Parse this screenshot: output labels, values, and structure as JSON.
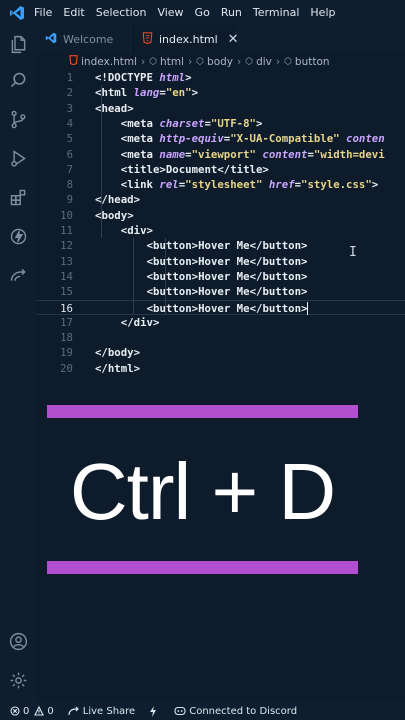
{
  "menu": [
    "File",
    "Edit",
    "Selection",
    "View",
    "Go",
    "Run",
    "Terminal",
    "Help"
  ],
  "tabs": [
    {
      "label": "Welcome",
      "active": false
    },
    {
      "label": "index.html",
      "active": true,
      "close": "✕"
    }
  ],
  "breadcrumb": [
    "index.html",
    "html",
    "body",
    "div",
    "button"
  ],
  "code_lines": [
    {
      "n": "1",
      "tokens": [
        [
          "t-br",
          "<!"
        ],
        [
          "t-tag",
          "DOCTYPE "
        ],
        [
          "t-attr",
          "html"
        ],
        [
          "t-br",
          ">"
        ]
      ],
      "indent": 0
    },
    {
      "n": "2",
      "tokens": [
        [
          "t-br",
          "<"
        ],
        [
          "t-tag",
          "html "
        ],
        [
          "t-attr",
          "lang"
        ],
        [
          "t-br",
          "="
        ],
        [
          "t-str",
          "\"en\""
        ],
        [
          "t-br",
          ">"
        ]
      ],
      "indent": 0
    },
    {
      "n": "3",
      "tokens": [
        [
          "t-br",
          "<"
        ],
        [
          "t-tag",
          "head"
        ],
        [
          "t-br",
          ">"
        ]
      ],
      "indent": 0
    },
    {
      "n": "4",
      "tokens": [
        [
          "t-br",
          "<"
        ],
        [
          "t-tag",
          "meta "
        ],
        [
          "t-attr",
          "charset"
        ],
        [
          "t-br",
          "="
        ],
        [
          "t-str",
          "\"UTF-8\""
        ],
        [
          "t-br",
          ">"
        ]
      ],
      "indent": 2
    },
    {
      "n": "5",
      "tokens": [
        [
          "t-br",
          "<"
        ],
        [
          "t-tag",
          "meta "
        ],
        [
          "t-attr",
          "http-equiv"
        ],
        [
          "t-br",
          "="
        ],
        [
          "t-str",
          "\"X-UA-Compatible\""
        ],
        [
          "t-txt",
          " "
        ],
        [
          "t-attr",
          "conten"
        ]
      ],
      "indent": 2
    },
    {
      "n": "6",
      "tokens": [
        [
          "t-br",
          "<"
        ],
        [
          "t-tag",
          "meta "
        ],
        [
          "t-attr",
          "name"
        ],
        [
          "t-br",
          "="
        ],
        [
          "t-str",
          "\"viewport\""
        ],
        [
          "t-txt",
          " "
        ],
        [
          "t-attr",
          "content"
        ],
        [
          "t-br",
          "="
        ],
        [
          "t-str",
          "\"width=devi"
        ]
      ],
      "indent": 2
    },
    {
      "n": "7",
      "tokens": [
        [
          "t-br",
          "<"
        ],
        [
          "t-tag",
          "title"
        ],
        [
          "t-br",
          ">"
        ],
        [
          "t-txt",
          "Document"
        ],
        [
          "t-br",
          "</"
        ],
        [
          "t-tag",
          "title"
        ],
        [
          "t-br",
          ">"
        ]
      ],
      "indent": 2
    },
    {
      "n": "8",
      "tokens": [
        [
          "t-br",
          "<"
        ],
        [
          "t-tag",
          "link "
        ],
        [
          "t-attr",
          "rel"
        ],
        [
          "t-br",
          "="
        ],
        [
          "t-str",
          "\"stylesheet\""
        ],
        [
          "t-txt",
          " "
        ],
        [
          "t-attr",
          "href"
        ],
        [
          "t-br",
          "="
        ],
        [
          "t-str",
          "\"style.css\""
        ],
        [
          "t-br",
          ">"
        ]
      ],
      "indent": 2
    },
    {
      "n": "9",
      "tokens": [
        [
          "t-br",
          "</"
        ],
        [
          "t-tag",
          "head"
        ],
        [
          "t-br",
          ">"
        ]
      ],
      "indent": 0
    },
    {
      "n": "10",
      "tokens": [
        [
          "t-br",
          "<"
        ],
        [
          "t-tag",
          "body"
        ],
        [
          "t-br",
          ">"
        ]
      ],
      "indent": 0
    },
    {
      "n": "11",
      "tokens": [
        [
          "t-br",
          "<"
        ],
        [
          "t-tag",
          "div"
        ],
        [
          "t-br",
          ">"
        ]
      ],
      "indent": 2
    },
    {
      "n": "12",
      "tokens": [
        [
          "t-br",
          "<"
        ],
        [
          "t-tag",
          "button"
        ],
        [
          "t-br",
          ">"
        ],
        [
          "t-txt",
          "Hover Me"
        ],
        [
          "t-br",
          "</"
        ],
        [
          "t-tag",
          "button"
        ],
        [
          "t-br",
          ">"
        ]
      ],
      "indent": 4
    },
    {
      "n": "13",
      "tokens": [
        [
          "t-br",
          "<"
        ],
        [
          "t-tag",
          "button"
        ],
        [
          "t-br",
          ">"
        ],
        [
          "t-txt",
          "Hover Me"
        ],
        [
          "t-br",
          "</"
        ],
        [
          "t-tag",
          "button"
        ],
        [
          "t-br",
          ">"
        ]
      ],
      "indent": 4
    },
    {
      "n": "14",
      "tokens": [
        [
          "t-br",
          "<"
        ],
        [
          "t-tag",
          "button"
        ],
        [
          "t-br",
          ">"
        ],
        [
          "t-txt",
          "Hover Me"
        ],
        [
          "t-br",
          "</"
        ],
        [
          "t-tag",
          "button"
        ],
        [
          "t-br",
          ">"
        ]
      ],
      "indent": 4
    },
    {
      "n": "15",
      "tokens": [
        [
          "t-br",
          "<"
        ],
        [
          "t-tag",
          "button"
        ],
        [
          "t-br",
          ">"
        ],
        [
          "t-txt",
          "Hover Me"
        ],
        [
          "t-br",
          "</"
        ],
        [
          "t-tag",
          "button"
        ],
        [
          "t-br",
          ">"
        ]
      ],
      "indent": 4
    },
    {
      "n": "16",
      "tokens": [
        [
          "t-br",
          "<"
        ],
        [
          "t-tag",
          "button"
        ],
        [
          "t-br",
          ">"
        ],
        [
          "t-txt",
          "Hover Me"
        ],
        [
          "t-br",
          "</"
        ],
        [
          "t-tag",
          "button"
        ],
        [
          "t-br",
          ">"
        ]
      ],
      "indent": 4,
      "current": true
    },
    {
      "n": "17",
      "tokens": [
        [
          "t-br",
          "</"
        ],
        [
          "t-tag",
          "div"
        ],
        [
          "t-br",
          ">"
        ]
      ],
      "indent": 2
    },
    {
      "n": "18",
      "tokens": [],
      "indent": 0
    },
    {
      "n": "19",
      "tokens": [
        [
          "t-br",
          "</"
        ],
        [
          "t-tag",
          "body"
        ],
        [
          "t-br",
          ">"
        ]
      ],
      "indent": 0
    },
    {
      "n": "20",
      "tokens": [
        [
          "t-br",
          "</"
        ],
        [
          "t-tag",
          "html"
        ],
        [
          "t-br",
          ">"
        ]
      ],
      "indent": 0
    }
  ],
  "overlay": {
    "shortcut": "Ctrl + D",
    "accent": "#b24fd0"
  },
  "status": {
    "errors": "0",
    "warnings": "0",
    "live_share": "Live Share",
    "discord": "Connected to Discord"
  },
  "colors": {
    "background": "#0d1b2a",
    "tag": "#e8edf3",
    "attribute": "#c9a4ff",
    "string": "#e8d58a",
    "vscode_logo": "#3aa0ff"
  }
}
